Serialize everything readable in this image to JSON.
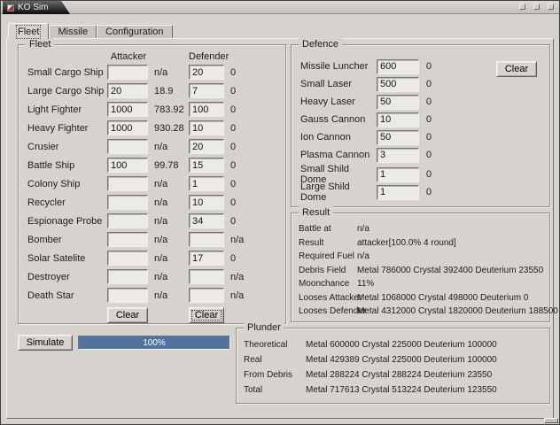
{
  "window": {
    "title": "KO Sim"
  },
  "tabs": {
    "items": [
      {
        "label": "Fleet"
      },
      {
        "label": "Missile"
      },
      {
        "label": "Configuration"
      }
    ]
  },
  "fleet": {
    "legend": "Fleet",
    "headers": {
      "attacker": "Attacker",
      "defender": "Defender"
    },
    "clear_attacker": "Clear",
    "clear_defender": "Clear",
    "rows": [
      {
        "label": "Small Cargo Ship",
        "att": "",
        "att_res": "n/a",
        "def": "20",
        "def_res": "0"
      },
      {
        "label": "Large Cargo Ship",
        "att": "20",
        "att_res": "18.9",
        "def": "7",
        "def_res": "0"
      },
      {
        "label": "Light Fighter",
        "att": "1000",
        "att_res": "783.92",
        "def": "100",
        "def_res": "0"
      },
      {
        "label": "Heavy Fighter",
        "att": "1000",
        "att_res": "930.28",
        "def": "10",
        "def_res": "0"
      },
      {
        "label": "Crusier",
        "att": "",
        "att_res": "n/a",
        "def": "20",
        "def_res": "0"
      },
      {
        "label": "Battle Ship",
        "att": "100",
        "att_res": "99.78",
        "def": "15",
        "def_res": "0"
      },
      {
        "label": "Colony Ship",
        "att": "",
        "att_res": "n/a",
        "def": "1",
        "def_res": "0"
      },
      {
        "label": "Recycler",
        "att": "",
        "att_res": "n/a",
        "def": "10",
        "def_res": "0"
      },
      {
        "label": "Espionage Probe",
        "att": "",
        "att_res": "n/a",
        "def": "34",
        "def_res": "0"
      },
      {
        "label": "Bomber",
        "att": "",
        "att_res": "n/a",
        "def": "",
        "def_res": "n/a"
      },
      {
        "label": "Solar Satelite",
        "att": "",
        "att_res": "n/a",
        "def": "17",
        "def_res": "0"
      },
      {
        "label": "Destroyer",
        "att": "",
        "att_res": "n/a",
        "def": "",
        "def_res": "n/a"
      },
      {
        "label": "Death Star",
        "att": "",
        "att_res": "n/a",
        "def": "",
        "def_res": "n/a"
      }
    ]
  },
  "defence": {
    "legend": "Defence",
    "clear": "Clear",
    "rows": [
      {
        "label": "Missile Luncher",
        "value": "600",
        "count": "0"
      },
      {
        "label": "Small Laser",
        "value": "500",
        "count": "0"
      },
      {
        "label": "Heavy Laser",
        "value": "50",
        "count": "0"
      },
      {
        "label": "Gauss Cannon",
        "value": "10",
        "count": "0"
      },
      {
        "label": "Ion Cannon",
        "value": "50",
        "count": "0"
      },
      {
        "label": "Plasma Cannon",
        "value": "3",
        "count": "0"
      },
      {
        "label": "Small Shild Dome",
        "value": "1",
        "count": "0"
      },
      {
        "label": "Large Shild Dome",
        "value": "1",
        "count": "0"
      }
    ]
  },
  "result": {
    "legend": "Result",
    "rows": [
      {
        "label": "Battle at",
        "value": "n/a"
      },
      {
        "label": "Result",
        "value": "attacker[100.0% 4 round]"
      },
      {
        "label": "Required Fuel",
        "value": "n/a"
      },
      {
        "label": "Debris Field",
        "value": "Metal 786000 Crystal 392400 Deuterium 23550"
      },
      {
        "label": "Moonchance",
        "value": "11%"
      },
      {
        "label": "Looses Attacker",
        "value": "Metal 1068000 Crystal 498000 Deuterium 0"
      },
      {
        "label": "Looses Defender",
        "value": "Metal 4312000 Crystal 1820000 Deuterium 188500"
      }
    ]
  },
  "controls": {
    "simulate": "Simulate",
    "progress_text": "100%",
    "progress_pct": 100
  },
  "plunder": {
    "legend": "Plunder",
    "rows": [
      {
        "label": "Theoretical",
        "value": "Metal 600000 Crystal 225000 Deuterium 100000"
      },
      {
        "label": "Real",
        "value": "Metal 429389 Crystal 225000 Deuterium 100000"
      },
      {
        "label": "From Debris",
        "value": "Metal 288224 Crystal 288224 Deuterium 23550"
      },
      {
        "label": "Total",
        "value": "Metal 717613 Crystal 513224 Deuterium 123550"
      }
    ]
  },
  "colors": {
    "progress_fill": "#52739e",
    "title_tab": "#141414",
    "background": "#d6d3ce"
  }
}
